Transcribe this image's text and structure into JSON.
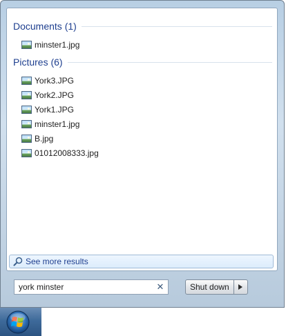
{
  "start_menu": {
    "groups": [
      {
        "title": "Documents (1)",
        "items": [
          {
            "label": "minster1.jpg",
            "icon": "image-file-icon"
          }
        ]
      },
      {
        "title": "Pictures (6)",
        "items": [
          {
            "label": "York3.JPG",
            "icon": "image-file-icon"
          },
          {
            "label": "York2.JPG",
            "icon": "image-file-icon"
          },
          {
            "label": "York1.JPG",
            "icon": "image-file-icon"
          },
          {
            "label": "minster1.jpg",
            "icon": "image-file-icon"
          },
          {
            "label": "B.jpg",
            "icon": "image-file-icon"
          },
          {
            "label": "01012008333.jpg",
            "icon": "image-file-icon"
          }
        ]
      }
    ],
    "see_more": {
      "label": "See more results",
      "icon": "search-icon"
    },
    "search": {
      "value": "york minster",
      "clear_icon": "clear-icon"
    },
    "shutdown": {
      "label": "Shut down",
      "arrow_icon": "chevron-right-icon"
    }
  },
  "taskbar": {
    "start_button_icon": "windows-logo-icon"
  },
  "colors": {
    "group_title": "#1e3f8f",
    "menu_background": "#d1e0ee",
    "taskbar": "#3e6a9a"
  }
}
